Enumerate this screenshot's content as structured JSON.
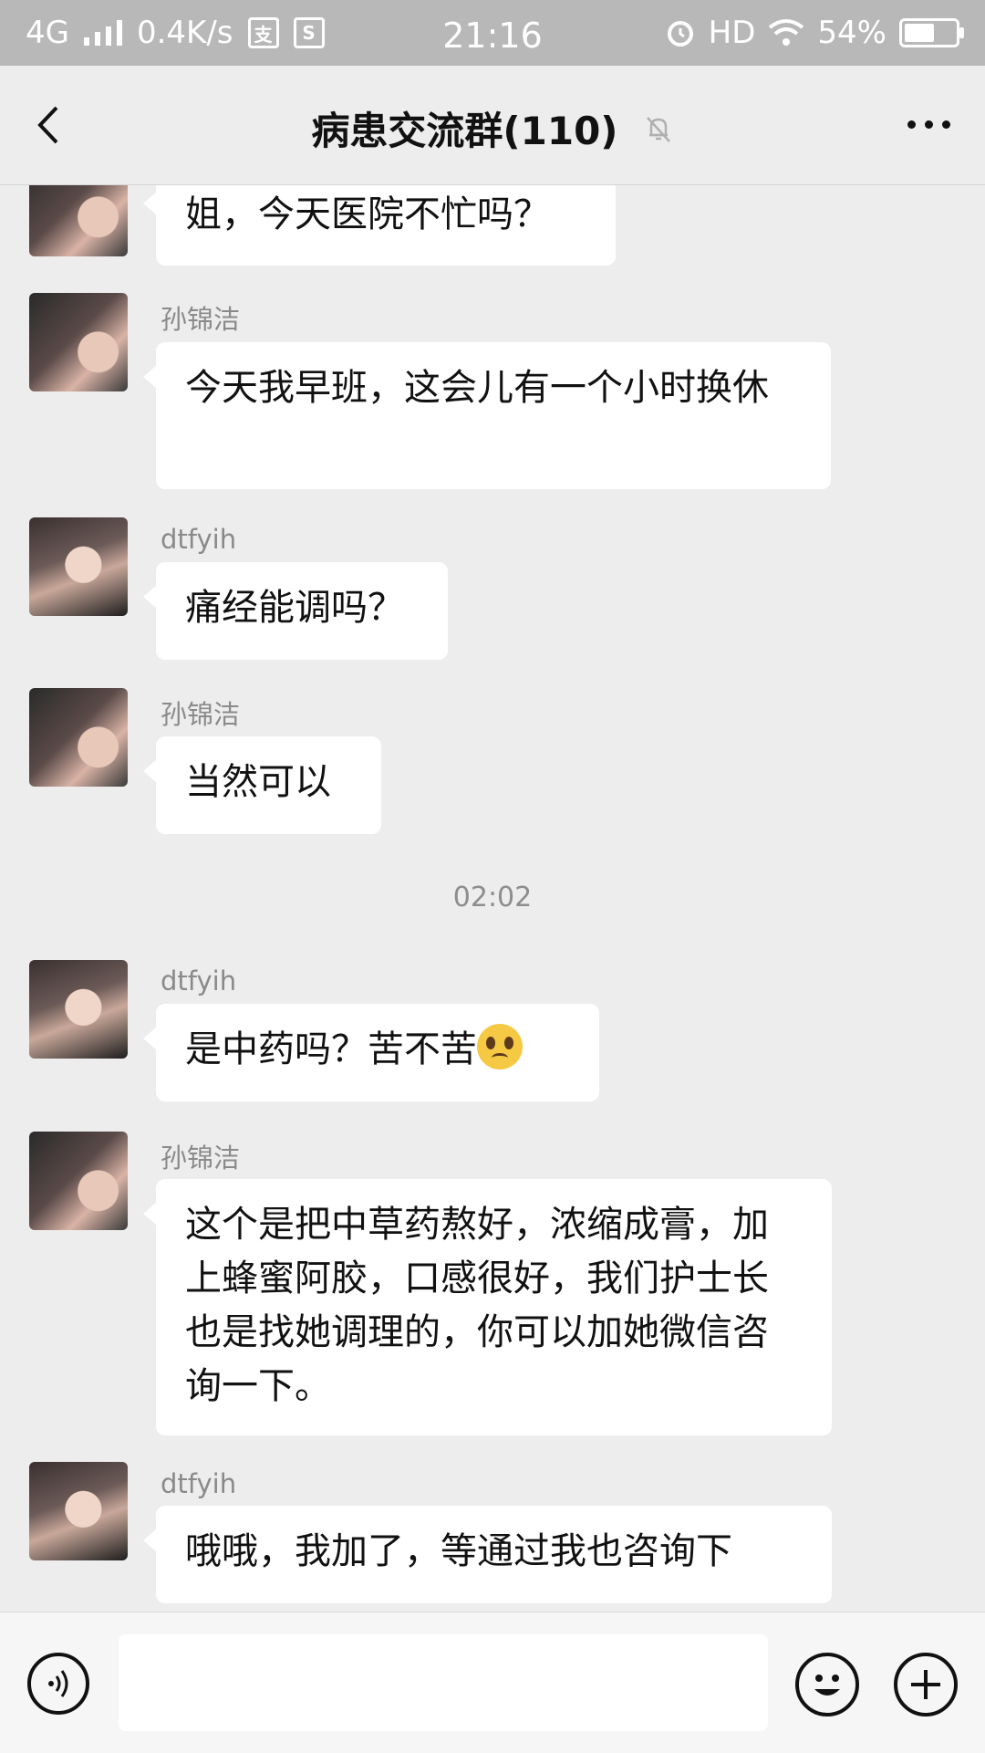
{
  "status_bar": {
    "network": "4G",
    "speed": "0.4K/s",
    "time": "21:16",
    "hd": "HD",
    "battery": "54%"
  },
  "header": {
    "title": "病患交流群(110)",
    "back_icon": "chevron-left-icon",
    "mute_icon": "bell-off-icon",
    "more_icon": "more-dots-icon"
  },
  "messages": [
    {
      "sender": "",
      "text": "姐，今天医院不忙吗？"
    },
    {
      "sender": "孙锦洁",
      "text": "今天我早班，这会儿有一个小时换休"
    },
    {
      "sender": "dtfyih",
      "text": "痛经能调吗？"
    },
    {
      "sender": "孙锦洁",
      "text": "当然可以"
    },
    {
      "sender": "dtfyih",
      "text": "是中药吗？苦不苦",
      "emoji": "crying-face-emoji"
    },
    {
      "sender": "孙锦洁",
      "text": "这个是把中草药熬好，浓缩成膏，加上蜂蜜阿胶，口感很好，我们护士长也是找她调理的，你可以加她微信咨询一下。"
    },
    {
      "sender": "dtfyih",
      "text": "哦哦，我加了，等通过我也咨询下"
    }
  ],
  "timestamp": "02:02",
  "input": {
    "value": "",
    "voice_icon": "voice-icon",
    "emoji_icon": "smiley-icon",
    "plus_icon": "plus-icon"
  },
  "colors": {
    "background": "#ededed",
    "bubble": "#ffffff",
    "status_bar": "#b8b8b8"
  }
}
